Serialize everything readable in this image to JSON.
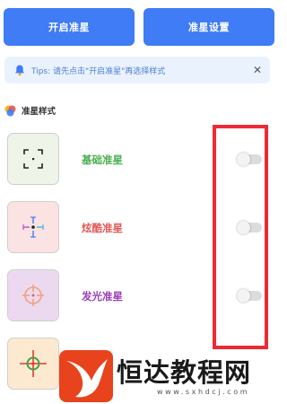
{
  "buttons": {
    "start_label": "开启准星",
    "settings_label": "准星设置"
  },
  "tips": {
    "text": "Tips: 请先点击\"开启准星\"再选择样式",
    "close_glyph": "✕",
    "icon": "bell-icon"
  },
  "section": {
    "title": "准星样式",
    "icon": "style-palette-icon"
  },
  "styles": [
    {
      "label": "基础准星",
      "color": "#4caf50",
      "thumb_bg": "#eef5e8",
      "icon": "basic-crosshair-icon",
      "enabled": false
    },
    {
      "label": "炫酷准星",
      "color": "#e05a5a",
      "thumb_bg": "#fbe3e4",
      "icon": "cool-crosshair-icon",
      "enabled": false
    },
    {
      "label": "发光准星",
      "color": "#9b3fb8",
      "thumb_bg": "#ecd9ef",
      "icon": "glow-crosshair-icon",
      "enabled": false
    },
    {
      "label": "",
      "color": "#e0a020",
      "thumb_bg": "#fde9cf",
      "icon": "target-crosshair-icon",
      "enabled": false
    }
  ],
  "watermark": {
    "title": "恒达教程网",
    "url": "www.sxhdcj.com"
  },
  "colors": {
    "accent": "#3f7cf5",
    "highlight_frame": "#ee2a35"
  }
}
